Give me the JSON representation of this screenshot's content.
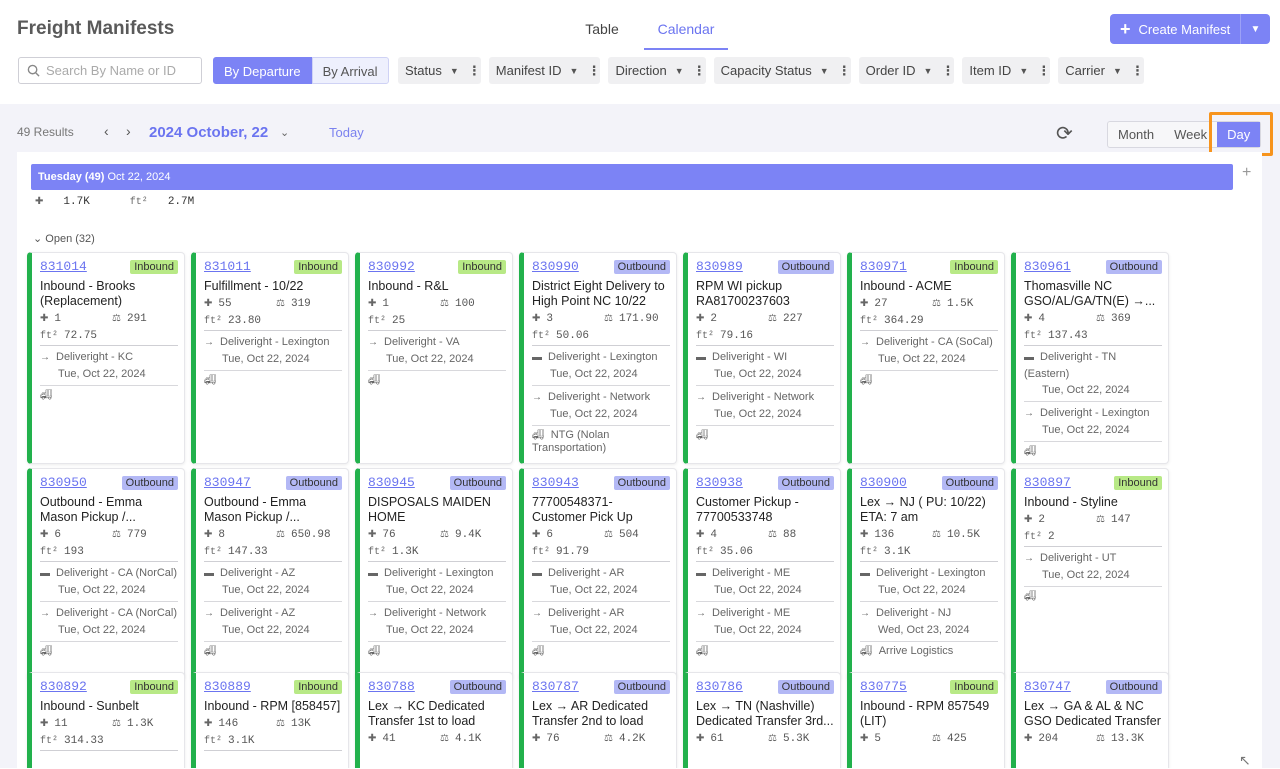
{
  "app": {
    "title": "Freight Manifests"
  },
  "view_tabs": [
    "Table",
    "Calendar"
  ],
  "create_button": "Create Manifest",
  "search": {
    "placeholder": "Search By Name or ID"
  },
  "mode": {
    "departure": "By Departure",
    "arrival": "By Arrival"
  },
  "filters": [
    "Status",
    "Manifest ID",
    "Direction",
    "Capacity Status",
    "Order ID",
    "Item ID",
    "Carrier"
  ],
  "toolbar": {
    "results": "49 Results",
    "date": "2024 October, 22",
    "today": "Today"
  },
  "range": [
    "Month",
    "Week",
    "Day"
  ],
  "day": {
    "label": "Tuesday (49)",
    "date": "Oct 22, 2024",
    "pieces": "1.7K",
    "sqft": "2.7M"
  },
  "group": "Open (32)",
  "colors": {
    "accent": "#7c83f5",
    "inbound": "#b8e986",
    "outbound": "#b3b8f5",
    "highlight": "#f7941d"
  },
  "cards": [
    {
      "id": "831014",
      "dir": "Inbound",
      "name": "Inbound - Brooks (Replacement)",
      "pcs": "1",
      "wt": "291",
      "ft": "72.75",
      "legs": [
        {
          "from": "Deliveright - KC",
          "date": "Tue, Oct 22, 2024"
        }
      ],
      "carrier": ""
    },
    {
      "id": "831011",
      "dir": "Inbound",
      "name": "Fulfillment - 10/22",
      "pcs": "55",
      "wt": "319",
      "ft": "23.80",
      "legs": [
        {
          "from": "Deliveright - Lexington",
          "date": "Tue, Oct 22, 2024"
        }
      ],
      "carrier": ""
    },
    {
      "id": "830992",
      "dir": "Inbound",
      "name": "Inbound - R&L",
      "pcs": "1",
      "wt": "100",
      "ft": "25",
      "legs": [
        {
          "from": "Deliveright - VA",
          "date": "Tue, Oct 22, 2024"
        }
      ],
      "carrier": ""
    },
    {
      "id": "830990",
      "dir": "Outbound",
      "name": "District Eight Delivery to High Point NC 10/22",
      "pcs": "3",
      "wt": "171.90",
      "ft": "50.06",
      "legs": [
        {
          "from": "Deliveright - Lexington",
          "date": "Tue, Oct 22, 2024"
        },
        {
          "from": "Deliveright - Network",
          "date": "Tue, Oct 22, 2024"
        }
      ],
      "carrier": "NTG (Nolan Transportation)"
    },
    {
      "id": "830989",
      "dir": "Outbound",
      "name": "RPM WI pickup RA81700237603",
      "pcs": "2",
      "wt": "227",
      "ft": "79.16",
      "legs": [
        {
          "from": "Deliveright - WI",
          "date": "Tue, Oct 22, 2024"
        },
        {
          "from": "Deliveright - Network",
          "date": "Tue, Oct 22, 2024"
        }
      ],
      "carrier": ""
    },
    {
      "id": "830971",
      "dir": "Inbound",
      "name": "Inbound - ACME",
      "pcs": "27",
      "wt": "1.5K",
      "ft": "364.29",
      "legs": [
        {
          "from": "Deliveright - CA (SoCal)",
          "date": "Tue, Oct 22, 2024"
        }
      ],
      "carrier": ""
    },
    {
      "id": "830961",
      "dir": "Outbound",
      "name": "Thomasville NC GSO/AL/GA/TN(E) →...",
      "pcs": "4",
      "wt": "369",
      "ft": "137.43",
      "legs": [
        {
          "from": "Deliveright - TN (Eastern)",
          "date": "Tue, Oct 22, 2024"
        },
        {
          "from": "Deliveright - Lexington",
          "date": "Tue, Oct 22, 2024"
        }
      ],
      "carrier": ""
    },
    {
      "id": "830950",
      "dir": "Outbound",
      "name": "Outbound - Emma Mason Pickup /...",
      "pcs": "6",
      "wt": "779",
      "ft": "193",
      "legs": [
        {
          "from": "Deliveright - CA (NorCal)",
          "date": "Tue, Oct 22, 2024"
        },
        {
          "from": "Deliveright - CA (NorCal)",
          "date": "Tue, Oct 22, 2024"
        }
      ],
      "carrier": ""
    },
    {
      "id": "830947",
      "dir": "Outbound",
      "name": "Outbound - Emma Mason Pickup /...",
      "pcs": "8",
      "wt": "650.98",
      "ft": "147.33",
      "legs": [
        {
          "from": "Deliveright - AZ",
          "date": "Tue, Oct 22, 2024"
        },
        {
          "from": "Deliveright - AZ",
          "date": "Tue, Oct 22, 2024"
        }
      ],
      "carrier": ""
    },
    {
      "id": "830945",
      "dir": "Outbound",
      "name": "DISPOSALS MAIDEN HOME",
      "pcs": "76",
      "wt": "9.4K",
      "ft": "1.3K",
      "legs": [
        {
          "from": "Deliveright - Lexington",
          "date": "Tue, Oct 22, 2024"
        },
        {
          "from": "Deliveright - Network",
          "date": "Tue, Oct 22, 2024"
        }
      ],
      "carrier": ""
    },
    {
      "id": "830943",
      "dir": "Outbound",
      "name": "77700548371- Customer Pick Up",
      "pcs": "6",
      "wt": "504",
      "ft": "91.79",
      "legs": [
        {
          "from": "Deliveright - AR",
          "date": "Tue, Oct 22, 2024"
        },
        {
          "from": "Deliveright - AR",
          "date": "Tue, Oct 22, 2024"
        }
      ],
      "carrier": ""
    },
    {
      "id": "830938",
      "dir": "Outbound",
      "name": "Customer Pickup - 77700533748",
      "pcs": "4",
      "wt": "88",
      "ft": "35.06",
      "legs": [
        {
          "from": "Deliveright - ME",
          "date": "Tue, Oct 22, 2024"
        },
        {
          "from": "Deliveright - ME",
          "date": "Tue, Oct 22, 2024"
        }
      ],
      "carrier": ""
    },
    {
      "id": "830900",
      "dir": "Outbound",
      "name": "Lex → NJ ( PU: 10/22) ETA: 7 am",
      "pcs": "136",
      "wt": "10.5K",
      "ft": "3.1K",
      "legs": [
        {
          "from": "Deliveright - Lexington",
          "date": "Tue, Oct 22, 2024"
        },
        {
          "from": "Deliveright - NJ",
          "date": "Wed, Oct 23, 2024"
        }
      ],
      "carrier": "Arrive Logistics"
    },
    {
      "id": "830897",
      "dir": "Inbound",
      "name": "Inbound - Styline",
      "pcs": "2",
      "wt": "147",
      "ft": "2",
      "legs": [
        {
          "from": "Deliveright - UT",
          "date": "Tue, Oct 22, 2024"
        }
      ],
      "carrier": ""
    },
    {
      "id": "830892",
      "dir": "Inbound",
      "name": "Inbound - Sunbelt",
      "pcs": "11",
      "wt": "1.3K",
      "ft": "314.33",
      "legs": [],
      "carrier": ""
    },
    {
      "id": "830889",
      "dir": "Inbound",
      "name": "Inbound - RPM [858457]",
      "pcs": "146",
      "wt": "13K",
      "ft": "3.1K",
      "legs": [],
      "carrier": ""
    },
    {
      "id": "830788",
      "dir": "Outbound",
      "name": "Lex → KC Dedicated Transfer 1st to load",
      "pcs": "41",
      "wt": "4.1K",
      "ft": "",
      "legs": [],
      "carrier": ""
    },
    {
      "id": "830787",
      "dir": "Outbound",
      "name": "Lex → AR Dedicated Transfer 2nd to load",
      "pcs": "76",
      "wt": "4.2K",
      "ft": "",
      "legs": [],
      "carrier": ""
    },
    {
      "id": "830786",
      "dir": "Outbound",
      "name": "Lex → TN (Nashville) Dedicated Transfer 3rd...",
      "pcs": "61",
      "wt": "5.3K",
      "ft": "",
      "legs": [],
      "carrier": ""
    },
    {
      "id": "830775",
      "dir": "Inbound",
      "name": "Inbound - RPM 857549 (LIT)",
      "pcs": "5",
      "wt": "425",
      "ft": "",
      "legs": [],
      "carrier": ""
    },
    {
      "id": "830747",
      "dir": "Outbound",
      "name": "Lex → GA & AL & NC GSO Dedicated Transfer",
      "pcs": "204",
      "wt": "13.3K",
      "ft": "",
      "legs": [],
      "carrier": ""
    }
  ]
}
